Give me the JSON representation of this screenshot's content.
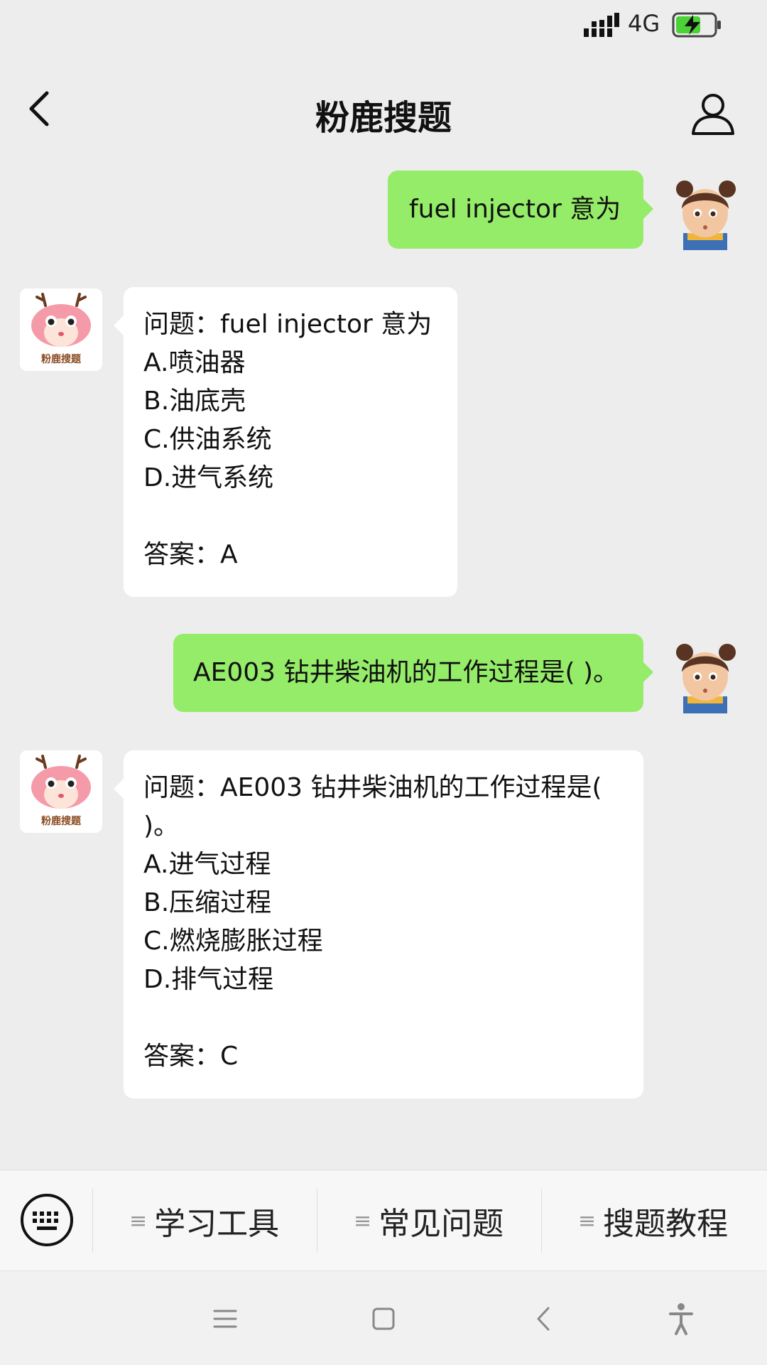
{
  "status": {
    "network": "4G"
  },
  "header": {
    "title": "粉鹿搜题"
  },
  "messages": [
    {
      "side": "right",
      "text": "fuel injector 意为"
    },
    {
      "side": "left",
      "lines": [
        "问题：fuel injector 意为",
        "A.喷油器",
        "B.油底壳",
        "C.供油系统",
        "D.进气系统"
      ],
      "answer": "答案：A"
    },
    {
      "side": "right",
      "text": "AE003 钻井柴油机的工作过程是( )。"
    },
    {
      "side": "left",
      "lines": [
        "问题：AE003 钻井柴油机的工作过程是( )。",
        "A.进气过程",
        "B.压缩过程",
        "C.燃烧膨胀过程",
        "D.排气过程"
      ],
      "answer": "答案：C"
    }
  ],
  "bot_avatar_label": "粉鹿搜题",
  "menu": [
    "学习工具",
    "常见问题",
    "搜题教程"
  ],
  "colors": {
    "bubble_user": "#95ec69",
    "bubble_bot": "#ffffff",
    "background": "#ededed"
  }
}
